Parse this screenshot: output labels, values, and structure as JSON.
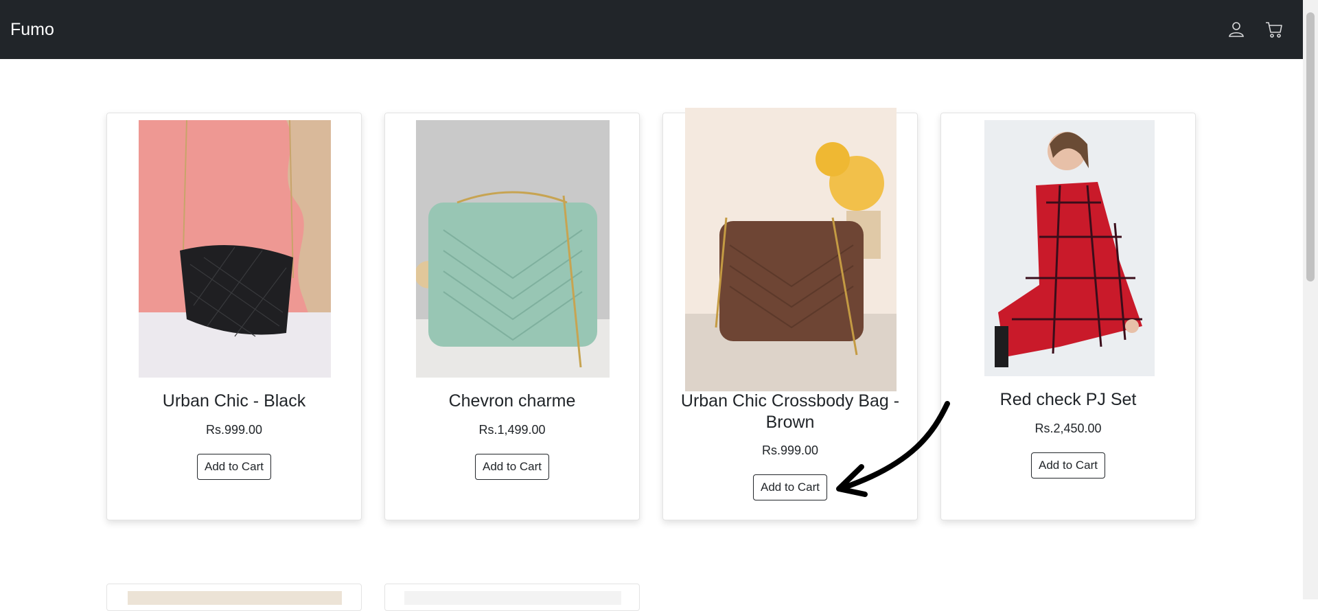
{
  "navbar": {
    "brand": "Fumo",
    "icons": [
      "user-icon",
      "cart-icon"
    ],
    "background": "#212529"
  },
  "products": [
    {
      "title": "Urban Chic - Black",
      "price": "Rs.999.00",
      "button": "Add to Cart"
    },
    {
      "title": "Chevron charme",
      "price": "Rs.1,499.00",
      "button": "Add to Cart"
    },
    {
      "title": "Urban Chic Crossbody Bag - Brown",
      "price": "Rs.999.00",
      "button": "Add to Cart"
    },
    {
      "title": "Red check PJ Set",
      "price": "Rs.2,450.00",
      "button": "Add to Cart"
    }
  ],
  "annotation": {
    "icon": "arrow-pointer-icon"
  }
}
